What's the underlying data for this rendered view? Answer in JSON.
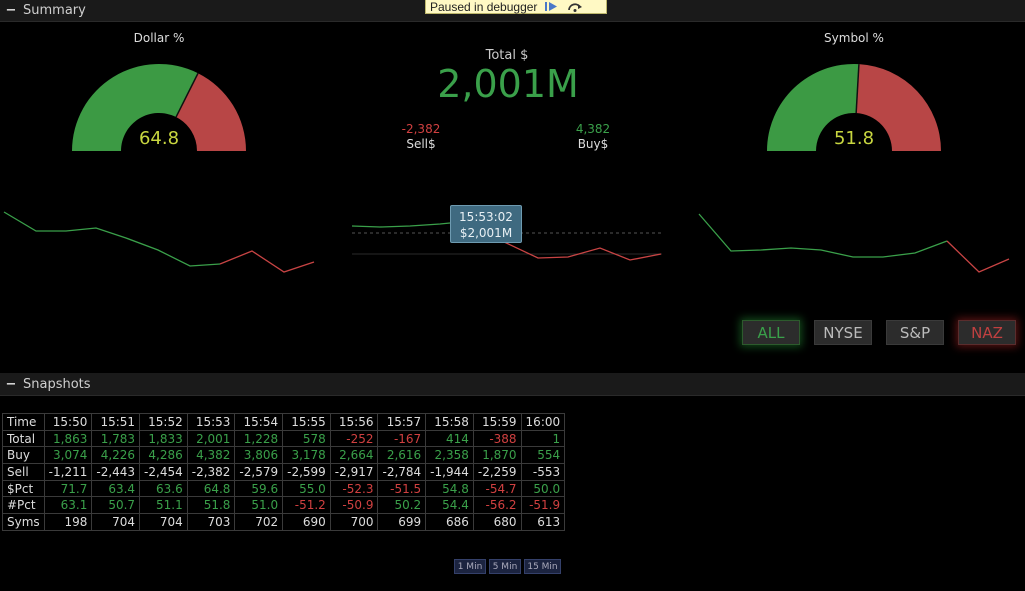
{
  "summary": {
    "collapse_symbol": "−",
    "title": "Summary"
  },
  "debugger": {
    "text": "Paused in debugger",
    "resume_icon": "resume-icon",
    "step_over_icon": "step-over-icon"
  },
  "dollar_gauge": {
    "title": "Dollar %",
    "value": "64.8",
    "green_fraction": 0.648,
    "green": "#3c9a44",
    "red": "#b84646"
  },
  "symbol_gauge": {
    "title": "Symbol %",
    "value": "51.8",
    "green_fraction": 0.518,
    "green": "#3c9a44",
    "red": "#b84646"
  },
  "total": {
    "label": "Total $",
    "value": "2,001M"
  },
  "sell": {
    "value": "-2,382",
    "label": "Sell$"
  },
  "buy": {
    "value": "4,382",
    "label": "Buy$"
  },
  "tooltip": {
    "time": "15:53:02",
    "value": "$2,001M"
  },
  "filters": {
    "all": "ALL",
    "nyse": "NYSE",
    "sp": "S&P",
    "naz": "NAZ"
  },
  "snapshots": {
    "collapse_symbol": "−",
    "title": "Snapshots",
    "headers": [
      "Time",
      "15:50",
      "15:51",
      "15:52",
      "15:53",
      "15:54",
      "15:55",
      "15:56",
      "15:57",
      "15:58",
      "15:59",
      "16:00"
    ],
    "rows": [
      {
        "label": "Total",
        "cells": [
          {
            "v": "1,863",
            "c": "pos"
          },
          {
            "v": "1,783",
            "c": "pos"
          },
          {
            "v": "1,833",
            "c": "pos"
          },
          {
            "v": "2,001",
            "c": "pos"
          },
          {
            "v": "1,228",
            "c": "pos"
          },
          {
            "v": "578",
            "c": "pos"
          },
          {
            "v": "-252",
            "c": "neg"
          },
          {
            "v": "-167",
            "c": "neg"
          },
          {
            "v": "414",
            "c": "pos"
          },
          {
            "v": "-388",
            "c": "neg"
          },
          {
            "v": "1",
            "c": "pos"
          }
        ]
      },
      {
        "label": "Buy",
        "cells": [
          {
            "v": "3,074",
            "c": "pos"
          },
          {
            "v": "4,226",
            "c": "pos"
          },
          {
            "v": "4,286",
            "c": "pos"
          },
          {
            "v": "4,382",
            "c": "pos"
          },
          {
            "v": "3,806",
            "c": "pos"
          },
          {
            "v": "3,178",
            "c": "pos"
          },
          {
            "v": "2,664",
            "c": "pos"
          },
          {
            "v": "2,616",
            "c": "pos"
          },
          {
            "v": "2,358",
            "c": "pos"
          },
          {
            "v": "1,870",
            "c": "pos"
          },
          {
            "v": "554",
            "c": "pos"
          }
        ]
      },
      {
        "label": "Sell",
        "cells": [
          {
            "v": "-1,211",
            "c": "neu"
          },
          {
            "v": "-2,443",
            "c": "neu"
          },
          {
            "v": "-2,454",
            "c": "neu"
          },
          {
            "v": "-2,382",
            "c": "neu"
          },
          {
            "v": "-2,579",
            "c": "neu"
          },
          {
            "v": "-2,599",
            "c": "neu"
          },
          {
            "v": "-2,917",
            "c": "neu"
          },
          {
            "v": "-2,784",
            "c": "neu"
          },
          {
            "v": "-1,944",
            "c": "neu"
          },
          {
            "v": "-2,259",
            "c": "neu"
          },
          {
            "v": "-553",
            "c": "neu"
          }
        ]
      },
      {
        "label": "$Pct",
        "cells": [
          {
            "v": "71.7",
            "c": "pos"
          },
          {
            "v": "63.4",
            "c": "pos"
          },
          {
            "v": "63.6",
            "c": "pos"
          },
          {
            "v": "64.8",
            "c": "pos"
          },
          {
            "v": "59.6",
            "c": "pos"
          },
          {
            "v": "55.0",
            "c": "pos"
          },
          {
            "v": "-52.3",
            "c": "neg"
          },
          {
            "v": "-51.5",
            "c": "neg"
          },
          {
            "v": "54.8",
            "c": "pos"
          },
          {
            "v": "-54.7",
            "c": "neg"
          },
          {
            "v": "50.0",
            "c": "pos"
          }
        ]
      },
      {
        "label": "#Pct",
        "cells": [
          {
            "v": "63.1",
            "c": "pos"
          },
          {
            "v": "50.7",
            "c": "pos"
          },
          {
            "v": "51.1",
            "c": "pos"
          },
          {
            "v": "51.8",
            "c": "pos"
          },
          {
            "v": "51.0",
            "c": "pos"
          },
          {
            "v": "-51.2",
            "c": "neg"
          },
          {
            "v": "-50.9",
            "c": "neg"
          },
          {
            "v": "50.2",
            "c": "pos"
          },
          {
            "v": "54.4",
            "c": "pos"
          },
          {
            "v": "-56.2",
            "c": "neg"
          },
          {
            "v": "-51.9",
            "c": "neg"
          }
        ]
      },
      {
        "label": "Syms",
        "cells": [
          {
            "v": "198",
            "c": "neu"
          },
          {
            "v": "704",
            "c": "neu"
          },
          {
            "v": "704",
            "c": "neu"
          },
          {
            "v": "703",
            "c": "neu"
          },
          {
            "v": "702",
            "c": "neu"
          },
          {
            "v": "690",
            "c": "neu"
          },
          {
            "v": "700",
            "c": "neu"
          },
          {
            "v": "699",
            "c": "neu"
          },
          {
            "v": "686",
            "c": "neu"
          },
          {
            "v": "680",
            "c": "neu"
          },
          {
            "v": "613",
            "c": "neu"
          }
        ]
      }
    ]
  },
  "intervals": {
    "one": "1 Min",
    "five": "5 Min",
    "fifteen": "15 Min"
  },
  "colors": {
    "positive": "#3aa04a",
    "negative": "#d04040"
  }
}
